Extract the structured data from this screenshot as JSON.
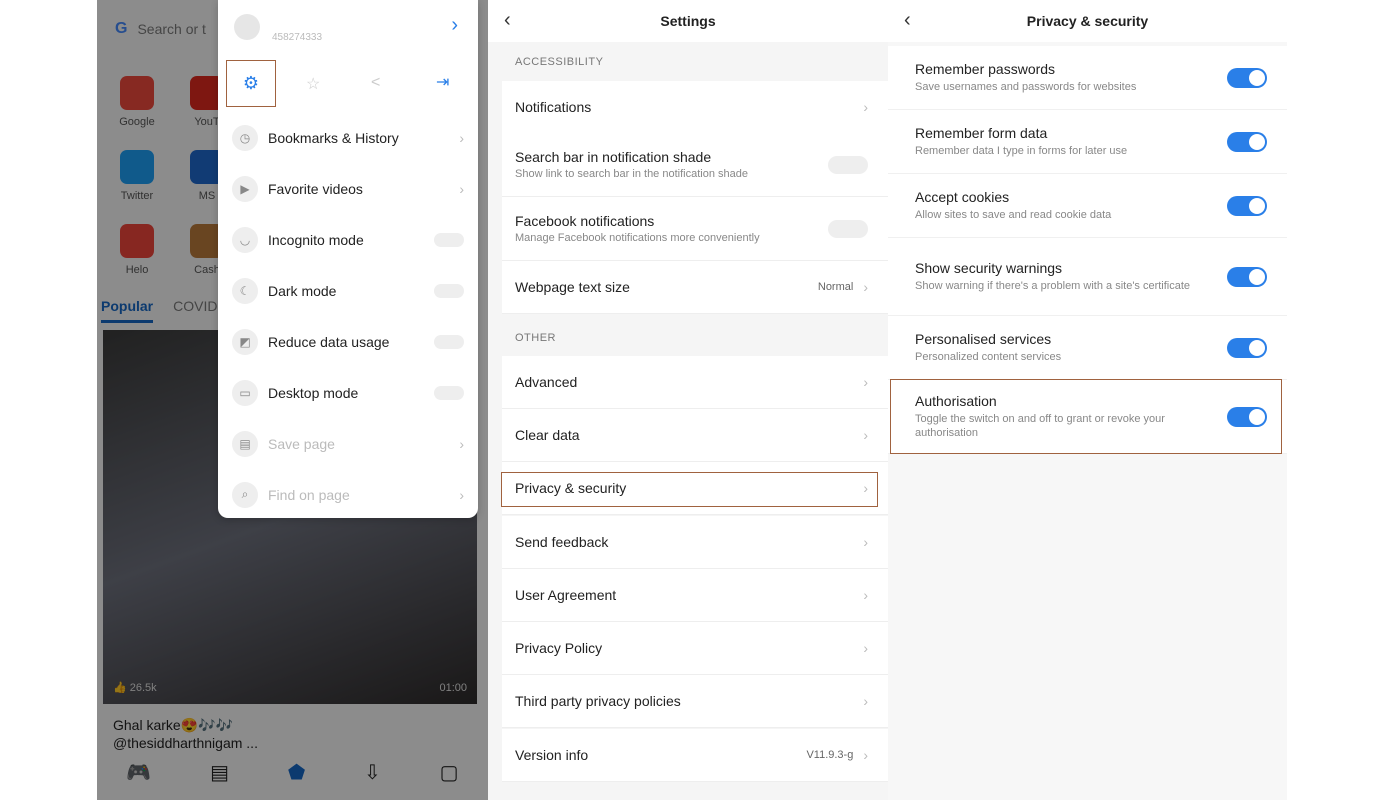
{
  "home": {
    "search_placeholder": "Search or t",
    "apps": [
      {
        "label": "Google",
        "color": "#e9473c"
      },
      {
        "label": "YouT",
        "color": "#d9281e"
      },
      {
        "label": "Twitter",
        "color": "#1d9bf0"
      },
      {
        "label": "MS",
        "color": "#1e66c8"
      },
      {
        "label": "Helo",
        "color": "#e8443a"
      },
      {
        "label": "Cash",
        "color": "#b5773a"
      }
    ],
    "tabs": [
      "Popular",
      "COVID-"
    ],
    "video": {
      "likes": "26.5k",
      "duration": "01:00",
      "caption1": "Ghal karke😍🎶🎶",
      "caption2": "@thesiddharthnigam ..."
    },
    "nav_icons": [
      "gamepad-icon",
      "news-icon",
      "home-icon",
      "download-icon",
      "tabs-icon"
    ],
    "accent": "#1565c0"
  },
  "menu": {
    "user_id": "458274333",
    "quick_icons": [
      "settings-icon",
      "star-icon",
      "share-icon",
      "exit-icon"
    ],
    "items": [
      {
        "label": "Bookmarks & History",
        "icon": "clock-icon",
        "control": "chevron"
      },
      {
        "label": "Favorite videos",
        "icon": "play-icon",
        "control": "chevron"
      },
      {
        "label": "Incognito mode",
        "icon": "mask-icon",
        "control": "toggle"
      },
      {
        "label": "Dark mode",
        "icon": "moon-icon",
        "control": "toggle"
      },
      {
        "label": "Reduce data usage",
        "icon": "data-icon",
        "control": "toggle"
      },
      {
        "label": "Desktop mode",
        "icon": "monitor-icon",
        "control": "toggle"
      },
      {
        "label": "Save page",
        "icon": "save-icon",
        "control": "chevron",
        "disabled": true
      },
      {
        "label": "Find on page",
        "icon": "search-icon",
        "control": "chevron",
        "disabled": true
      }
    ]
  },
  "settings": {
    "title": "Settings",
    "sections": [
      "ACCESSIBILITY",
      "OTHER"
    ],
    "rows": [
      {
        "title": "Notifications"
      },
      {
        "title": "Search bar in notification shade",
        "sub": "Show link to search bar in the notification shade",
        "toggle": false
      },
      {
        "title": "Facebook notifications",
        "sub": "Manage Facebook notifications more conveniently",
        "toggle": false
      },
      {
        "title": "Webpage text size",
        "value": "Normal"
      },
      {
        "title": "Advanced"
      },
      {
        "title": "Clear data"
      },
      {
        "title": "Privacy & security"
      },
      {
        "title": "Send feedback"
      },
      {
        "title": "User Agreement"
      },
      {
        "title": "Privacy Policy"
      },
      {
        "title": "Third party privacy policies"
      },
      {
        "title": "Version info",
        "value": "V11.9.3-g"
      }
    ]
  },
  "privacy": {
    "title": "Privacy & security",
    "toggle_color": "#2a7fe8",
    "rows": [
      {
        "title": "Remember passwords",
        "sub": "Save usernames and passwords for websites",
        "on": true
      },
      {
        "title": "Remember form data",
        "sub": "Remember data I type in forms for later use",
        "on": true
      },
      {
        "title": "Accept cookies",
        "sub": "Allow sites to save and read cookie data",
        "on": true
      },
      {
        "title": "Show security warnings",
        "sub": "Show warning if there's a problem with a site's certificate",
        "on": true
      },
      {
        "title": "Personalised services",
        "sub": "Personalized content services",
        "on": true
      },
      {
        "title": "Authorisation",
        "sub": "Toggle the switch on and off to grant or revoke your authorisation",
        "on": true
      }
    ]
  }
}
